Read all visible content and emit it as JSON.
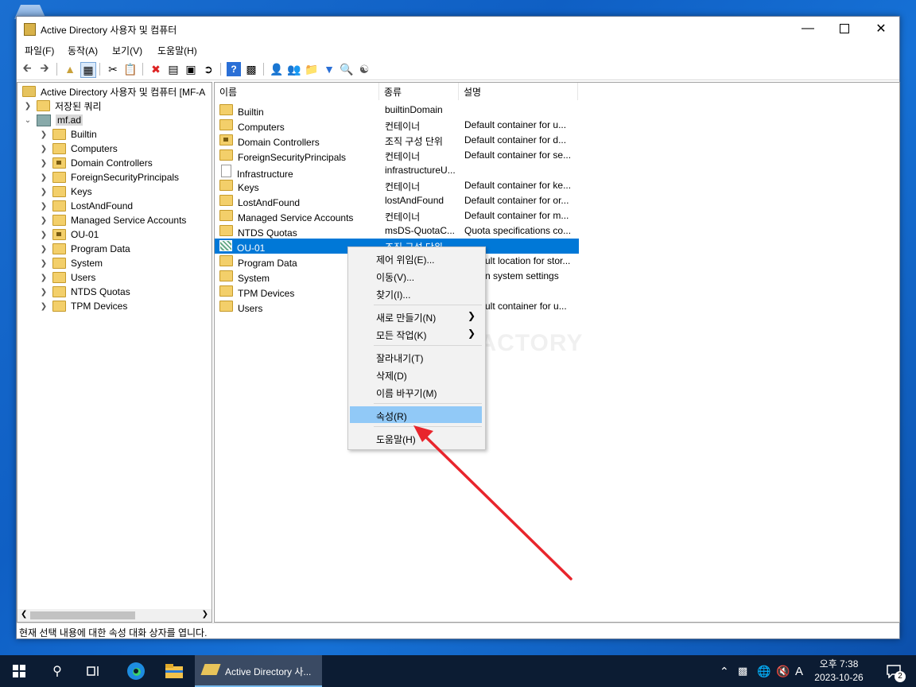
{
  "window": {
    "title": "Active Directory 사용자 및 컴퓨터"
  },
  "menu": [
    "파일(F)",
    "동작(A)",
    "보기(V)",
    "도움말(H)"
  ],
  "tree": {
    "root": "Active Directory 사용자 및 컴퓨터 [MF-A",
    "saved_queries": "저장된 쿼리",
    "domain": "mf.ad",
    "children": [
      "Builtin",
      "Computers",
      "Domain Controllers",
      "ForeignSecurityPrincipals",
      "Keys",
      "LostAndFound",
      "Managed Service Accounts",
      "OU-01",
      "Program Data",
      "System",
      "Users",
      "NTDS Quotas",
      "TPM Devices"
    ]
  },
  "list": {
    "columns": [
      "이름",
      "종류",
      "설명"
    ],
    "rows": [
      {
        "name": "Builtin",
        "type": "builtinDomain",
        "desc": ""
      },
      {
        "name": "Computers",
        "type": "컨테이너",
        "desc": "Default container for u..."
      },
      {
        "name": "Domain Controllers",
        "type": "조직 구성 단위",
        "desc": "Default container for d..."
      },
      {
        "name": "ForeignSecurityPrincipals",
        "type": "컨테이너",
        "desc": "Default container for se..."
      },
      {
        "name": "Infrastructure",
        "type": "infrastructureU...",
        "desc": ""
      },
      {
        "name": "Keys",
        "type": "컨테이너",
        "desc": "Default container for ke..."
      },
      {
        "name": "LostAndFound",
        "type": "lostAndFound",
        "desc": "Default container for or..."
      },
      {
        "name": "Managed Service Accounts",
        "type": "컨테이너",
        "desc": "Default container for m..."
      },
      {
        "name": "NTDS Quotas",
        "type": "msDS-QuotaC...",
        "desc": "Quota specifications co..."
      },
      {
        "name": "OU-01",
        "type": "조직 구성 단위",
        "desc": ""
      },
      {
        "name": "Program Data",
        "type": "",
        "desc": "ult location for stor..."
      },
      {
        "name": "System",
        "type": "",
        "desc": "n system settings"
      },
      {
        "name": "TPM Devices",
        "type": "",
        "desc": ""
      },
      {
        "name": "Users",
        "type": "",
        "desc": "ult container for u..."
      }
    ]
  },
  "context_menu": {
    "delegate": "제어 위임(E)...",
    "move": "이동(V)...",
    "find": "찾기(I)...",
    "new": "새로 만들기(N)",
    "all_tasks": "모든 작업(K)",
    "cut": "잘라내기(T)",
    "delete": "삭제(D)",
    "rename": "이름 바꾸기(M)",
    "properties": "속성(R)",
    "help": "도움말(H)"
  },
  "watermark": "MANUAL FACTORY",
  "status": "현재 선택 내용에 대한 속성 대화 상자를 엽니다.",
  "taskbar": {
    "app_label": "Active Directory 사...",
    "ime": "A",
    "time": "오후 7:38",
    "date": "2023-10-26",
    "notification_count": "2"
  },
  "colors": {
    "selection": "#0078d7",
    "highlight": "#91c9f7",
    "arrow": "#e8252c",
    "taskbar": "#0c1c33"
  }
}
